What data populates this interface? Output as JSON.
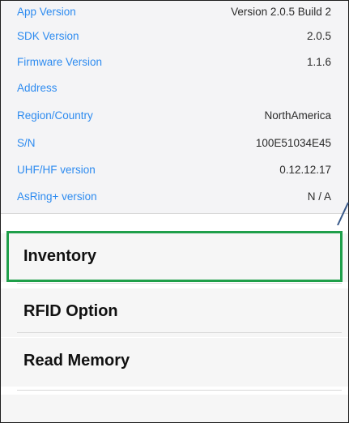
{
  "info": {
    "rows": [
      {
        "key": "App Version",
        "value": "Version 2.0.5 Build 2"
      },
      {
        "key": "SDK Version",
        "value": "2.0.5"
      },
      {
        "key": "Firmware Version",
        "value": "1.1.6"
      },
      {
        "key": "Address",
        "value": ""
      },
      {
        "key": "Region/Country",
        "value": "NorthAmerica"
      },
      {
        "key": "S/N",
        "value": "100E51034E45"
      },
      {
        "key": "UHF/HF version",
        "value": "0.12.12.17"
      },
      {
        "key": "AsRing+ version",
        "value": "N / A"
      }
    ]
  },
  "menu": {
    "items": [
      {
        "label": "Inventory"
      },
      {
        "label": "RFID Option"
      },
      {
        "label": "Read Memory"
      }
    ]
  },
  "colors": {
    "key_text": "#2d8bf0",
    "highlight_border": "#1f9f4a"
  }
}
